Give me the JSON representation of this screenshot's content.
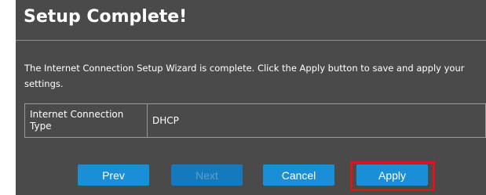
{
  "wizard": {
    "title": "Setup Complete!",
    "description": "The Internet Connection Setup Wizard is complete. Click the Apply button to save and apply your settings.",
    "summary": {
      "rows": [
        {
          "label": "Internet Connection Type",
          "value": "DHCP"
        }
      ]
    },
    "buttons": {
      "prev": "Prev",
      "next": "Next",
      "cancel": "Cancel",
      "apply": "Apply"
    },
    "colors": {
      "panel_background": "#4a4a4a",
      "button": "#1a8fd8",
      "highlight": "#d9151e"
    }
  }
}
